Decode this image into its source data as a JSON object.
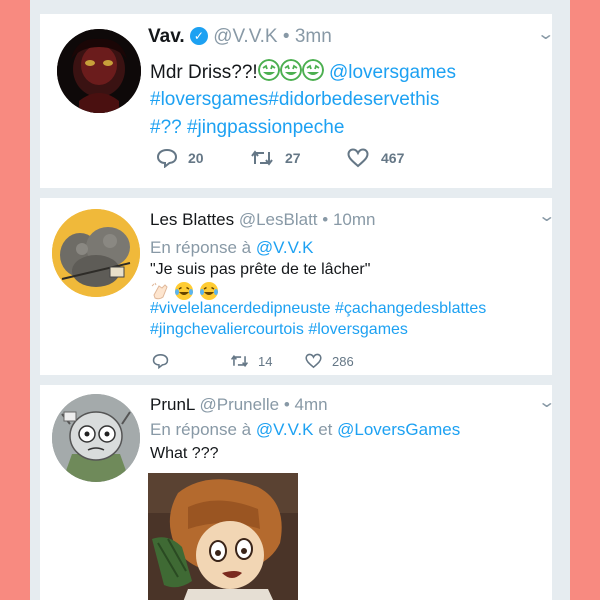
{
  "tweets": [
    {
      "display_name": "Vav.",
      "handle": "@V.V.K",
      "separator": "•",
      "time": "3mn",
      "text_start": "Mdr Driss??!",
      "emoji_names": [
        "crying-laughing-face-icon",
        "crying-laughing-face-icon",
        "crying-laughing-face-icon"
      ],
      "line1_link": "@loversgames",
      "line2_links": [
        "#loversgames",
        "#didorbedeservethis"
      ],
      "line3_links": [
        "#??",
        "#jingpassionpeche"
      ],
      "reply_count": "20",
      "retweet_count": "27",
      "like_count": "467"
    },
    {
      "display_name": "Les Blattes",
      "handle": "@LesBlatt",
      "separator": "•",
      "time": "10mn",
      "reply_prefix": "En réponse à",
      "reply_to": "@V.V.K",
      "quote": "\"Je suis pas prête de te lâcher\"",
      "emoji_names": [
        "clapping-hands-icon",
        "crying-laughing-face-icon",
        "crying-laughing-face-icon"
      ],
      "line1_links": [
        "#vivelelancerdedipneuste",
        "#çachangedesblattes"
      ],
      "line2_links": [
        "#jingchevaliercourtois",
        "#loversgames"
      ],
      "retweet_count": "14",
      "like_count": "286"
    },
    {
      "display_name": "PrunL",
      "handle": "@Prunelle",
      "separator": "•",
      "time": "4mn",
      "reply_prefix": "En réponse à",
      "reply_to_1": "@V.V.K",
      "reply_joiner": "et",
      "reply_to_2": "@LoversGames",
      "text": "What ???"
    }
  ],
  "colors": {
    "page_background": "#f88a80",
    "timeline_background": "#e6ecf0",
    "link": "#1da1f2",
    "muted": "#8899a6"
  }
}
